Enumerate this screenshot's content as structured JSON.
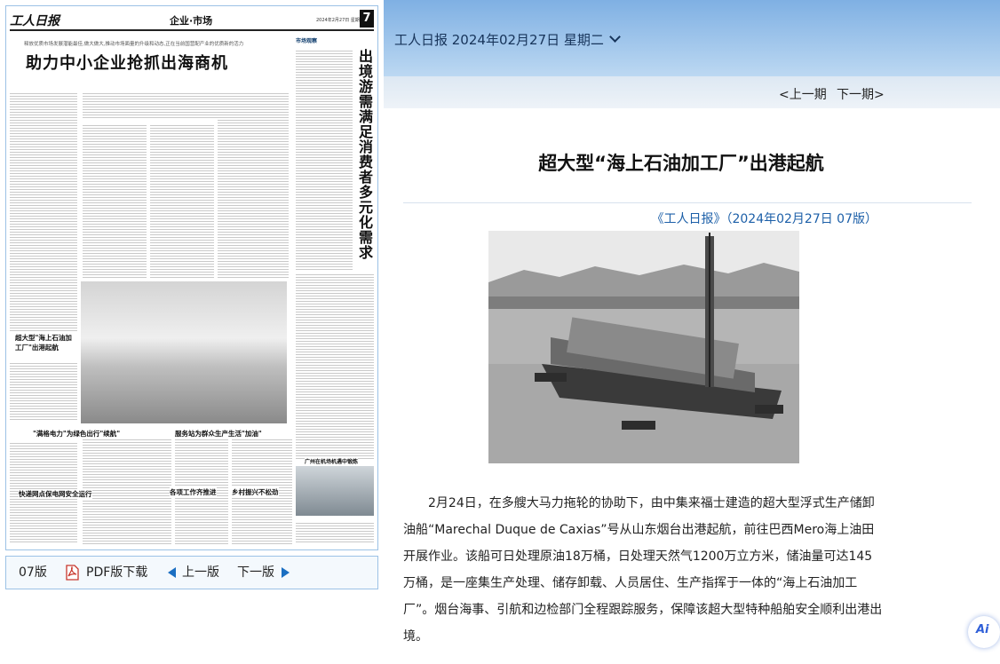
{
  "newspaper": {
    "masthead_logo": "工人日报",
    "section": "企业·市场",
    "date_small": "2024年2月27日 星期二",
    "page_number": "7",
    "kicker": "释放优质市场发展潜能最佳,做大做大,推动市场面量的升级和动态,正在当前国营配产业的优质新的活力",
    "headline": "助力中小企业抢抓出海商机",
    "vertical_headline": "出境游需满足消费者多元化需求",
    "market_label": "市场观察",
    "photo_caption_head": "超大型\"海上石油加工厂\"出港起航",
    "sub_heads": [
      "\"满格电力\"为绿色出行\"续航\"",
      "服务站为群众生产生活\"加油\"",
      "快递网点保电网安全运行",
      "各项工作齐推进",
      "乡村振兴不松劲",
      "广州在机场机遇中锻炼"
    ]
  },
  "toolbar": {
    "edition_label": "07版",
    "pdf_label": "PDF版下载",
    "prev_label": "上一版",
    "next_label": "下一版"
  },
  "top": {
    "date_select_value": "工人日报 2024年02月27日 星期二",
    "prev_issue": "<上一期",
    "next_issue": "下一期>"
  },
  "article": {
    "title": "超大型“海上石油加工厂”出港起航",
    "source": "《工人日报》（2024年02月27日 07版）",
    "body": "2月24日，在多艘大马力拖轮的协助下，由中集来福士建造的超大型浮式生产储卸油船“Marechal Duque de Caxias”号从山东烟台出港起航，前往巴西Mero海上油田开展作业。该船可日处理原油18万桶，日处理天然气1200万立方米，储油量可达145万桶，是一座集生产处理、储存卸载、人员居住、生产指挥于一体的“海上石油加工厂”。烟台海事、引航和边检部门全程跟踪服务，保障该超大型特种船舶安全顺利出港出境。"
  },
  "ai_button_label": "Ai",
  "colors": {
    "accent_blue": "#1c5fa8",
    "top_bar": "#7fb0e3",
    "arrow_blue": "#1b6fc2"
  }
}
